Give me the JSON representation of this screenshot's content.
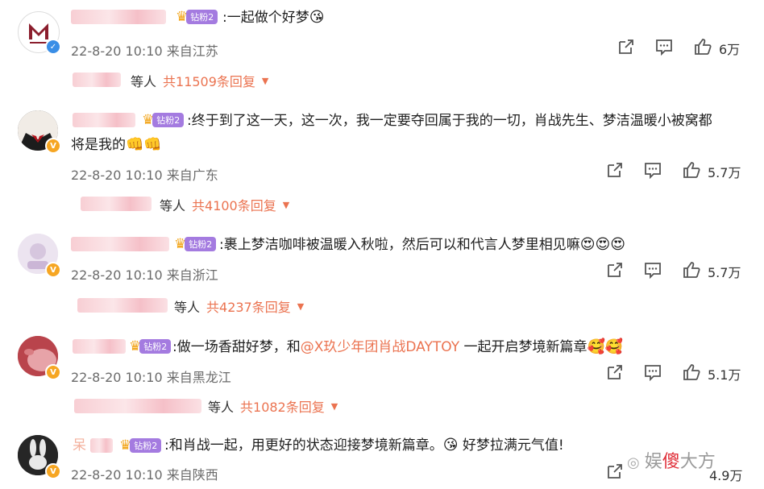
{
  "comments": [
    {
      "badge": "钻粉2",
      "text": ":一起做个好梦",
      "emoji": "😘",
      "time": "22-8-20 10:10",
      "location": "来自江苏",
      "likes": "6万",
      "replies_prefix": "等人",
      "replies": "共11509条回复"
    },
    {
      "badge": "钻粉2",
      "text_line1": ":终于到了这一天，这一次，我一定要夺回属于我的一切，肖战先生、梦洁温暖小被窝都",
      "text_line2": "将是我的",
      "emoji": "👊👊",
      "time": "22-8-20 10:10",
      "location": "来自广东",
      "likes": "5.7万",
      "replies_prefix": "等人",
      "replies": "共4100条回复"
    },
    {
      "badge": "钻粉2",
      "text": ":裹上梦洁咖啡被温暖入秋啦，然后可以和代言人梦里相见嘛",
      "emoji": "😍😍😍",
      "time": "22-8-20 10:10",
      "location": "来自浙江",
      "likes": "5.7万",
      "replies_prefix": "等人",
      "replies": "共4237条回复"
    },
    {
      "badge": "钻粉2",
      "text_before": ":做一场香甜好梦，和",
      "mention": "@X玖少年团肖战DAYTOY",
      "text_after": " 一起开启梦境新篇章",
      "emoji": "🥰🥰",
      "time": "22-8-20 10:10",
      "location": "来自黑龙江",
      "likes": "5.1万",
      "replies_prefix": "等人",
      "replies": "共1082条回复"
    },
    {
      "name_visible": "呆",
      "badge": "钻粉2",
      "text": ":和肖战一起，用更好的状态迎接梦境新篇章。",
      "emoji": "😘",
      "text_tail": " 好梦拉满元气值!",
      "time": "22-8-20 10:10",
      "location": "来自陕西",
      "likes": "4.9万"
    }
  ],
  "watermark": {
    "prefix": "娱",
    "highlight": "傻",
    "suffix": "大方"
  },
  "icons": {
    "share": "share-icon",
    "comment": "comment-icon",
    "like": "thumbs-up-icon",
    "reply_toggle": "caret-down-icon"
  },
  "colors": {
    "accent": "#eb7350",
    "badge_purple": "#a47be0",
    "meta": "#6b6b6b"
  }
}
